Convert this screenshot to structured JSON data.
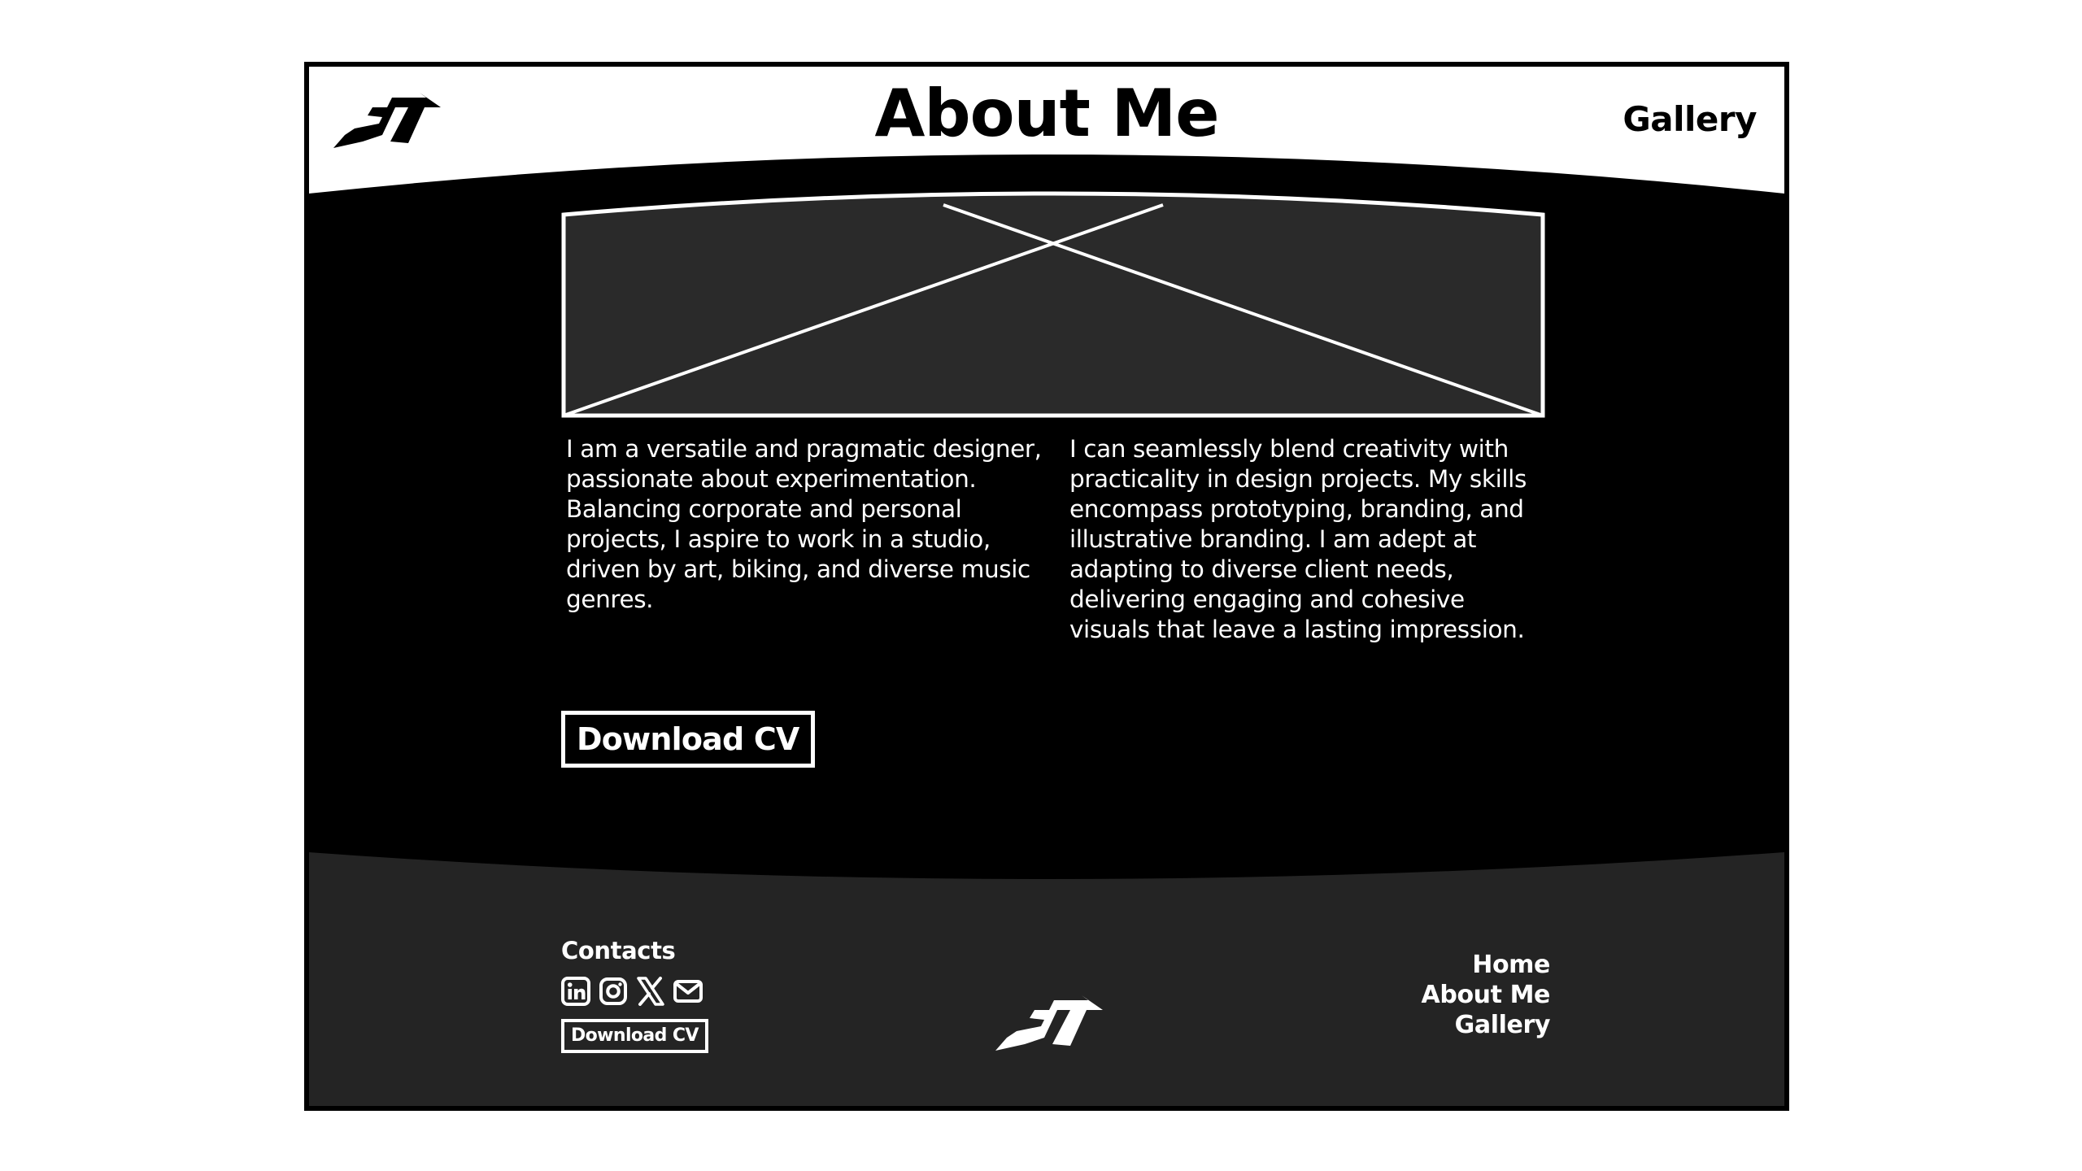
{
  "header": {
    "title": "About Me",
    "nav_gallery": "Gallery",
    "logo_icon": "brand-logo-icon"
  },
  "hero": {
    "image_icon": "image-placeholder-icon"
  },
  "about": {
    "left_text": "I am a versatile and pragmatic designer, passionate about experimentation. Balancing corporate and personal projects, I aspire to work in a studio, driven by art, biking, and diverse music genres.",
    "right_text": "I can seamlessly blend creativity with practicality in design projects. My skills encompass prototyping, branding, and illustrative branding. I am adept at adapting to diverse client needs, delivering engaging and cohesive visuals that leave a lasting impression.",
    "download_cv_label": "Download CV"
  },
  "footer": {
    "contacts_label": "Contacts",
    "social_icons": [
      "linkedin-icon",
      "instagram-icon",
      "x-icon",
      "mail-icon"
    ],
    "download_cv_label": "Download CV",
    "nav": [
      "Home",
      "About Me",
      "Gallery"
    ]
  },
  "colors": {
    "background": "#000000",
    "header_background": "#ffffff",
    "footer_background": "#242424",
    "placeholder_fill": "#2a2a2a",
    "text_light": "#ffffff",
    "text_dark": "#000000"
  }
}
